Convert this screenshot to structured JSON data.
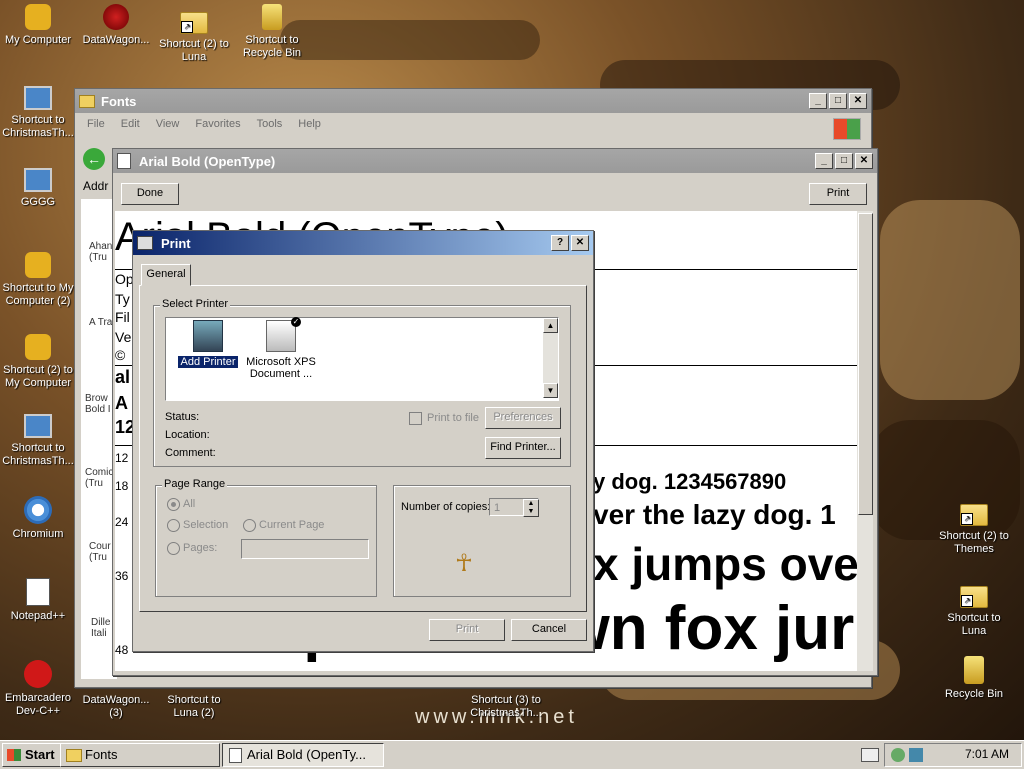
{
  "desktop": {
    "icons_left": [
      {
        "label": "My Computer"
      },
      {
        "label": "DataWagon..."
      },
      {
        "label": "Shortcut (2) to Luna"
      },
      {
        "label": "Shortcut to Recycle Bin"
      },
      {
        "label": "Shortcut to ChristmasTh..."
      },
      {
        "label": "GGGG"
      },
      {
        "label": "Shortcut to My Computer (2)"
      },
      {
        "label": "Shortcut (2) to My Computer"
      },
      {
        "label": "Shortcut to ChristmasTh..."
      },
      {
        "label": "Chromium"
      },
      {
        "label": "Notepad++"
      },
      {
        "label": "Embarcadero Dev-C++"
      },
      {
        "label": "DataWagon... (3)"
      },
      {
        "label": "Shortcut to Luna (2)"
      },
      {
        "label": "Shortcut (3) to ChristmasTh..."
      }
    ],
    "icons_right": [
      {
        "label": "Shortcut (2) to Themes"
      },
      {
        "label": "Shortcut to Luna"
      },
      {
        "label": "Recycle Bin"
      }
    ],
    "watermark": "www.mnk.net"
  },
  "fonts_window": {
    "title": "Fonts",
    "menu": [
      "File",
      "Edit",
      "View",
      "Favorites",
      "Tools",
      "Help"
    ],
    "address_label": "Addr",
    "side_items": [
      "Ahan (Tru",
      "A Tran",
      "Brow Bold I",
      "Comic (Tru",
      "Cour (Tru",
      "Dille Itali"
    ]
  },
  "font_viewer": {
    "title": "Arial Bold (OpenType)",
    "done_label": "Done",
    "print_label": "Print",
    "heading": "Arial Bold (OpenType)",
    "info_lines": [
      "Op",
      "Ty",
      "Fil",
      "Ve",
      "©"
    ],
    "bold_lines": [
      "al",
      "A",
      "12"
    ],
    "sample_sizes": [
      "12",
      "18",
      "24",
      "36",
      "48"
    ],
    "samples": [
      "y dog. 1234567890",
      "ver the lazy dog. 1",
      "x jumps ove",
      "The quick brown fox jur"
    ]
  },
  "print_dialog": {
    "title": "Print",
    "help_btn": "?",
    "close_btn": "✕",
    "tab_general": "General",
    "select_printer_label": "Select Printer",
    "printers": [
      {
        "name": "Add Printer",
        "selected": true
      },
      {
        "name": "Microsoft XPS Document ...",
        "selected": false
      }
    ],
    "status_label": "Status:",
    "location_label": "Location:",
    "comment_label": "Comment:",
    "print_to_file_label": "Print to file",
    "preferences_label": "Preferences",
    "find_printer_label": "Find Printer...",
    "page_range_label": "Page Range",
    "range_all": "All",
    "range_selection": "Selection",
    "range_current": "Current Page",
    "range_pages": "Pages:",
    "copies_label": "Number of copies:",
    "copies_value": "1",
    "print_btn": "Print",
    "cancel_btn": "Cancel"
  },
  "taskbar": {
    "start_label": "Start",
    "tasks": [
      {
        "label": "Fonts",
        "active": false
      },
      {
        "label": "Arial Bold (OpenTy...",
        "active": true
      }
    ],
    "clock": "7:01 AM"
  }
}
